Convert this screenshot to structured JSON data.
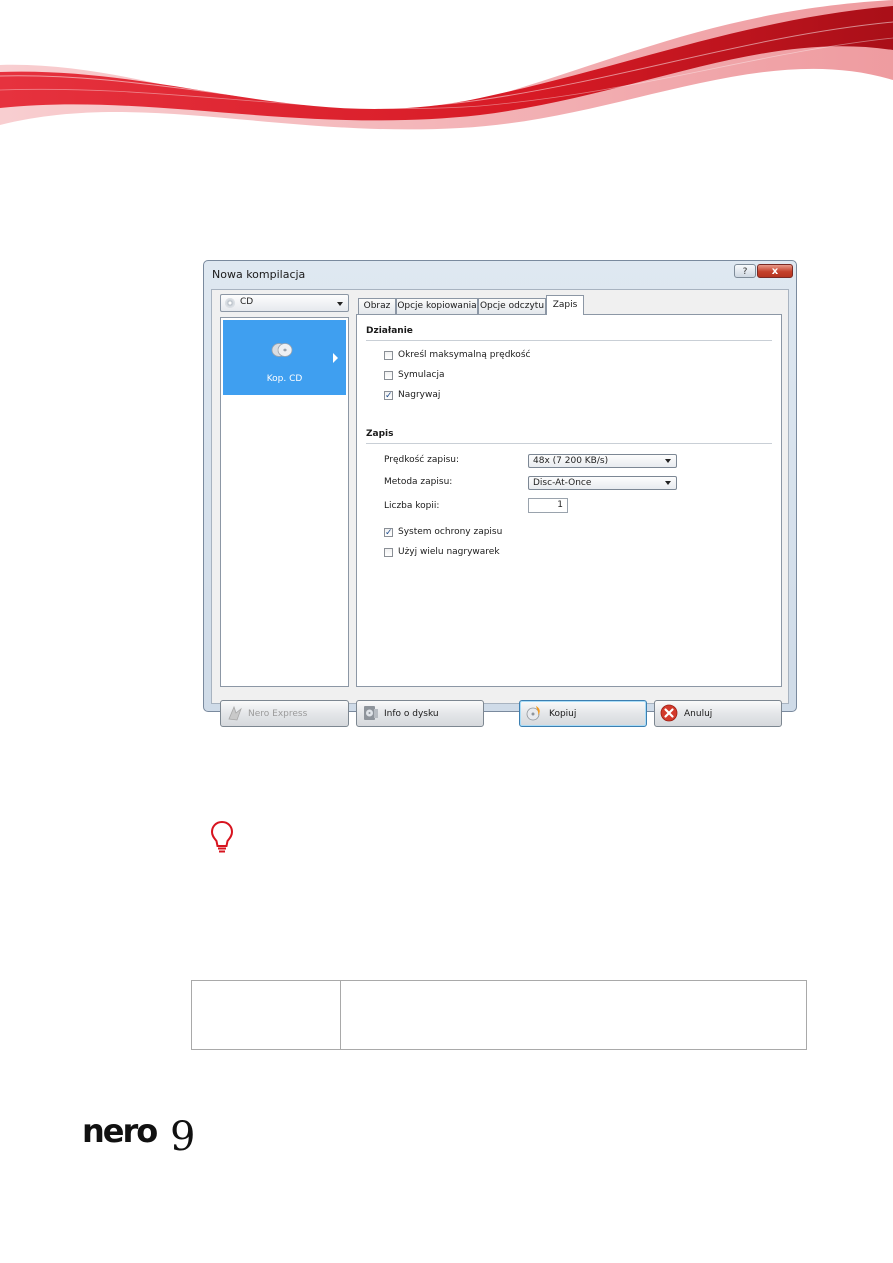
{
  "dialog": {
    "title": "Nowa kompilacja",
    "help_label": "?",
    "close_label": "x"
  },
  "left": {
    "media_select": "CD",
    "item_label": "Kop. CD"
  },
  "tabs": [
    {
      "label": "Obraz",
      "active": false
    },
    {
      "label": "Opcje kopiowania",
      "active": false
    },
    {
      "label": "Opcje odczytu",
      "active": false
    },
    {
      "label": "Zapis",
      "active": true
    }
  ],
  "dzialanie": {
    "title": "Działanie",
    "options": [
      {
        "label": "Określ maksymalną prędkość",
        "checked": false
      },
      {
        "label": "Symulacja",
        "checked": false
      },
      {
        "label": "Nagrywaj",
        "checked": true
      }
    ]
  },
  "zapis": {
    "title": "Zapis",
    "speed_label": "Prędkość zapisu:",
    "speed_value": "48x (7 200 KB/s)",
    "method_label": "Metoda zapisu:",
    "method_value": "Disc-At-Once",
    "copies_label": "Liczba kopii:",
    "copies_value": "1",
    "options": [
      {
        "label": "System ochrony zapisu",
        "checked": true
      },
      {
        "label": "Użyj wielu nagrywarek",
        "checked": false
      }
    ]
  },
  "buttons": {
    "nero_express": "Nero Express",
    "disc_info": "Info o dysku",
    "copy": "Kopiuj",
    "cancel": "Anuluj"
  },
  "colors": {
    "selection_blue": "#3f9ff0",
    "brand_red": "#d7141f"
  }
}
